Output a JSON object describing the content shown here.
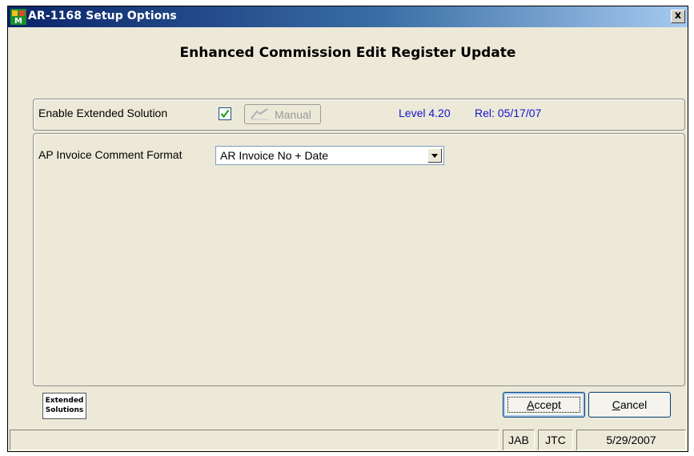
{
  "window": {
    "title": "AR-1168 Setup Options",
    "close_glyph": "x",
    "app_icon": "mas90-app-icon"
  },
  "heading": "Enhanced Commission Edit Register Update",
  "options": {
    "enable_label": "Enable Extended Solution",
    "enable_checked": true,
    "manual_label": "Manual",
    "level": "Level 4.20",
    "release": "Rel: 05/17/07"
  },
  "format": {
    "label": "AP Invoice Comment Format",
    "selected": "AR Invoice No + Date"
  },
  "logo": {
    "line1": "Extended",
    "line2": "Solutions"
  },
  "buttons": {
    "accept_mnemonic": "A",
    "accept_rest": "ccept",
    "cancel_mnemonic": "C",
    "cancel_rest": "ancel"
  },
  "status": {
    "message": "",
    "user": "JAB",
    "company": "JTC",
    "date": "5/29/2007"
  },
  "colors": {
    "title_start": "#0a246a",
    "title_end": "#a6caf0",
    "dialog_bg": "#ece9d8",
    "info_blue": "#1414d2",
    "check_green": "#21a121"
  }
}
